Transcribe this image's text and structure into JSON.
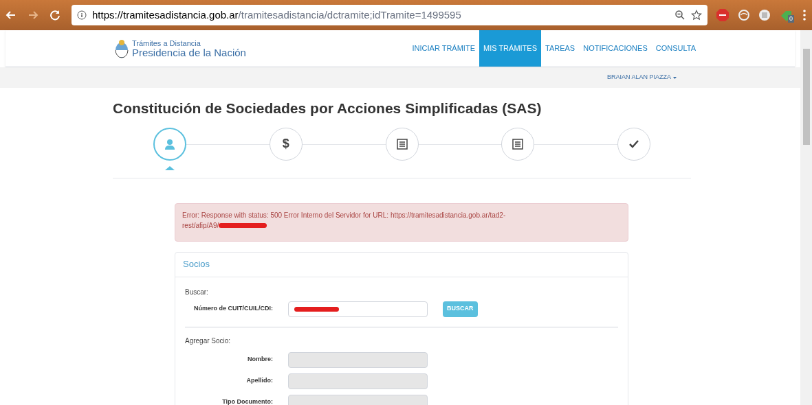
{
  "browser": {
    "url_host": "https://tramitesadistancia.gob.ar",
    "url_path": "/tramitesadistancia/dctramite;idTramite=1499595",
    "extension_badge": "0"
  },
  "header": {
    "brand_line_1": "Trámites a Distancia",
    "brand_line_2": "Presidencia de la Nación",
    "nav": [
      {
        "label": "INICIAR TRÁMITE",
        "selected": false
      },
      {
        "label": "MIS TRÁMITES",
        "selected": true
      },
      {
        "label": "TAREAS",
        "selected": false
      },
      {
        "label": "NOTIFICACIONES",
        "selected": false
      },
      {
        "label": "CONSULTA",
        "selected": false
      }
    ],
    "user": "BRAIAN ALAN PIAZZA"
  },
  "page_title": "Constitución de Sociedades por Acciones Simplificadas (SAS)",
  "steps": [
    {
      "kind": "user",
      "selected": true
    },
    {
      "kind": "text",
      "label": "$",
      "selected": false
    },
    {
      "kind": "list",
      "selected": false
    },
    {
      "kind": "list",
      "selected": false
    },
    {
      "kind": "check",
      "selected": false
    }
  ],
  "error": {
    "text_line_1": "Error: Response with status: 500 Error Interno del Servidor for URL: https://tramitesadistancia.gob.ar/tad2-",
    "text_line_2": "rest/afip/A9/"
  },
  "socios": {
    "title": "Socios",
    "search_heading": "Buscar:",
    "search_label": "Número de CUIT/CUIL/CDI:",
    "search_button": "BUSCAR",
    "add_heading": "Agregar Socio:",
    "fields": [
      {
        "label": "Nombre:",
        "disabled": true
      },
      {
        "label": "Apellido:",
        "disabled": true
      },
      {
        "label": "Tipo Documento:",
        "disabled": true
      }
    ]
  }
}
